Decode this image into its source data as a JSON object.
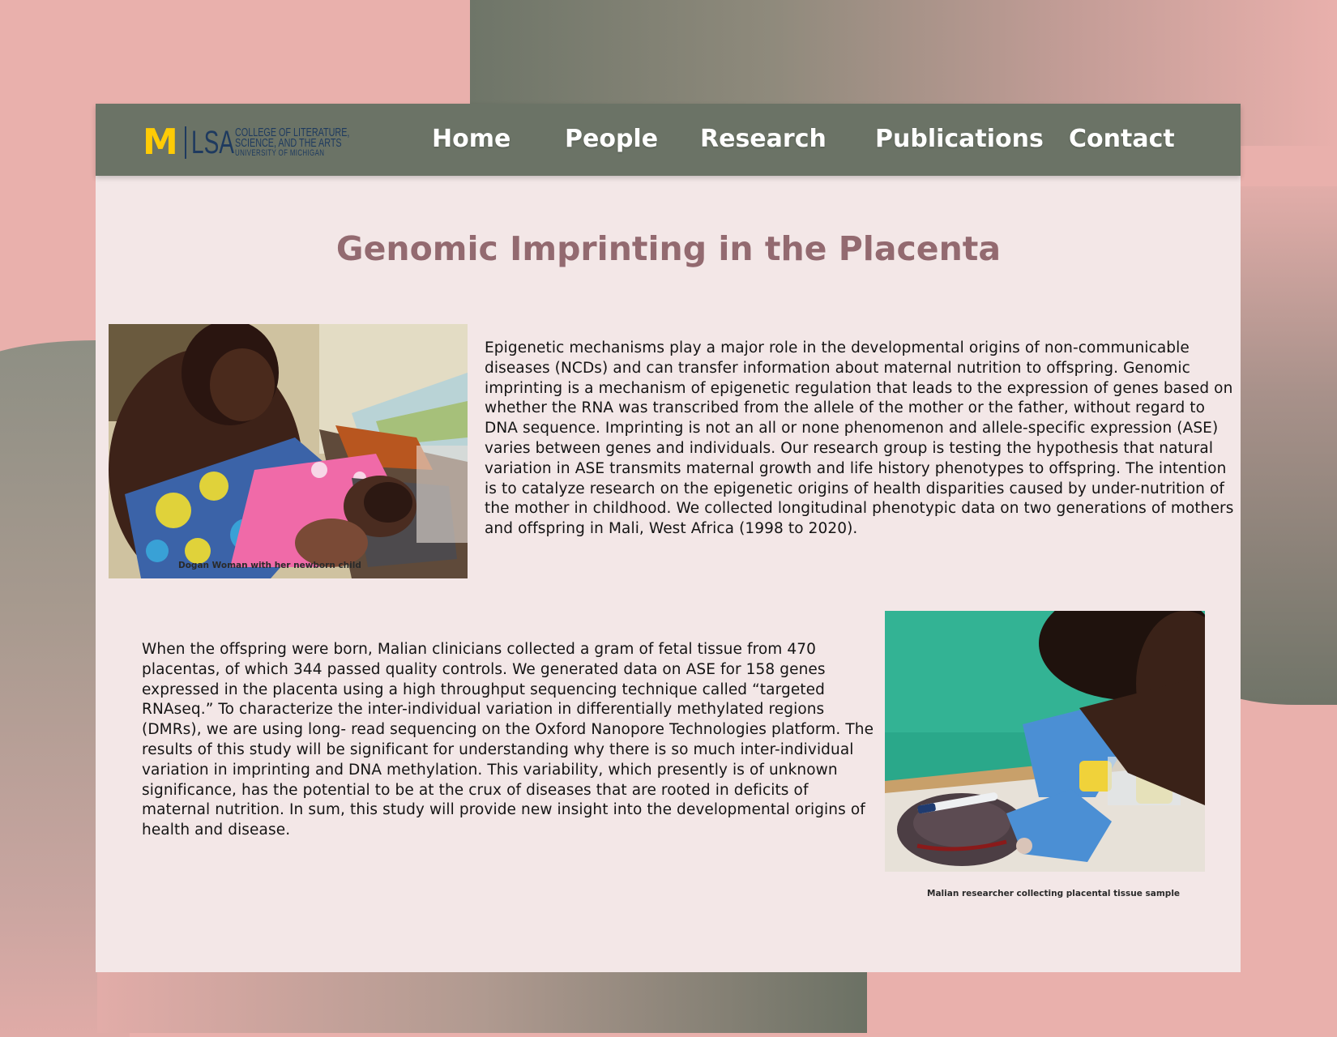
{
  "logo": {
    "block_m": "M",
    "lsa": "LSA",
    "college_line1": "COLLEGE OF LITERATURE,",
    "college_line2": "SCIENCE, AND THE ARTS",
    "university": "UNIVERSITY OF MICHIGAN"
  },
  "nav": {
    "home": "Home",
    "people": "People",
    "research": "Research",
    "publications": "Publications",
    "contact": "Contact"
  },
  "page": {
    "title": "Genomic Imprinting in the Placenta"
  },
  "section1": {
    "image_caption": "Dogan Woman with her newborn child",
    "paragraph": "Epigenetic mechanisms play a major role in the developmental origins of non-communicable diseases (NCDs) and can transfer information about maternal nutrition to offspring. Genomic imprinting is a mechanism of epigenetic regulation that leads to the expression of genes based on whether the RNA was transcribed from the allele of the mother or the father, without regard to DNA sequence. Imprinting is not an all or none phenomenon and allele-specific expression (ASE) varies between genes and individuals. Our research group is testing the hypothesis that natural variation in ASE transmits maternal growth and life history phenotypes to offspring. The intention is to catalyze research on the epigenetic origins of health disparities caused by under-nutrition of the mother in childhood. We collected longitudinal phenotypic data on two generations of mothers and offspring in Mali, West Africa (1998 to 2020)."
  },
  "section2": {
    "image_caption": "Malian researcher collecting placental tissue sample",
    "paragraph": "When the offspring were born, Malian clinicians collected a gram of fetal tissue from 470 placentas, of which 344 passed quality controls. We generated data on ASE for 158 genes expressed in the placenta using a high throughput sequencing technique called “targeted RNAseq.” To characterize the inter-individual variation in differentially methylated regions (DMRs), we are using long- read sequencing on the Oxford Nanopore Technologies platform. The results of this study will be significant for understanding why there is so much inter-individual variation in imprinting and DNA methylation. This variability, which presently is of unknown significance, has the potential to be at the crux of diseases that are rooted in deficits of maternal nutrition. In sum, this study will provide new insight into the developmental origins of health and disease."
  },
  "colors": {
    "background": "#e9b0ac",
    "navbar": "#6b7366",
    "card": "#f3e7e7",
    "title": "#936a70",
    "michigan_maize": "#ffcb05",
    "michigan_blue": "#1e3a5f"
  }
}
